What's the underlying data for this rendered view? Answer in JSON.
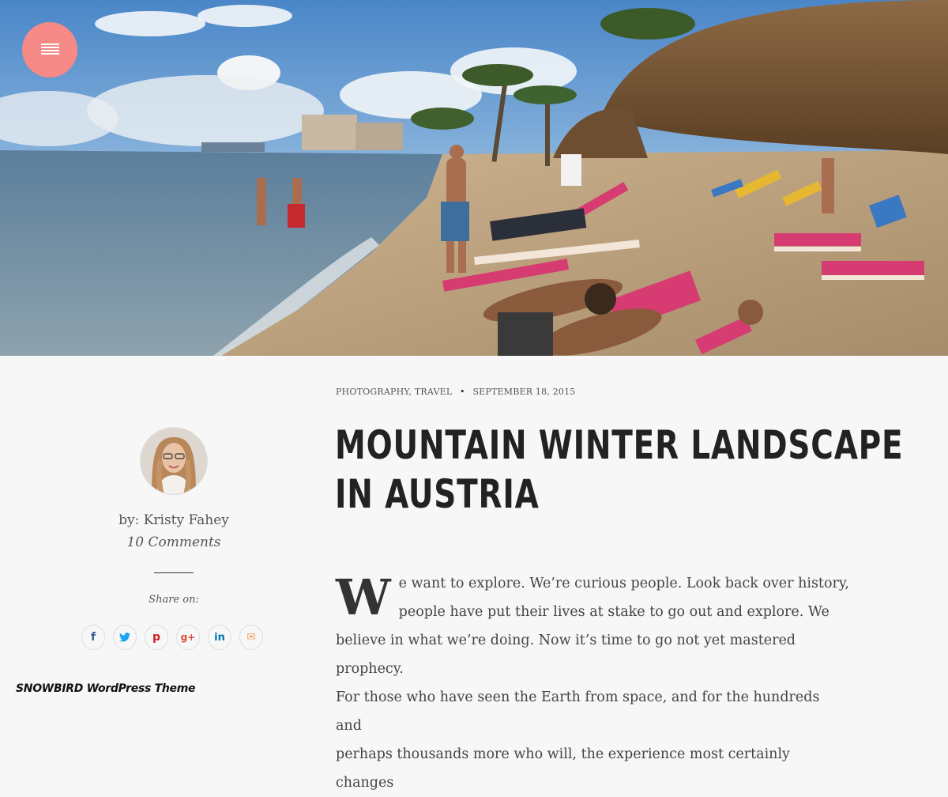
{
  "menu": {
    "icon": "hamburger-menu-icon"
  },
  "hero": {
    "description_icon": "beach-photo"
  },
  "post": {
    "categories": [
      "Photography",
      "Travel"
    ],
    "category_separator": ",",
    "dot": "•",
    "date": "September 18, 2015",
    "title_line1": "MOUNTAIN WINTER LANDSCAPE",
    "title_line2": "IN AUSTRIA",
    "dropcap": "W",
    "body_line1": "e want to explore. We’re curious people. Look back over history,",
    "body_line2": "people have put their lives at stake to go out and explore. We",
    "body_line3": "believe in what we’re doing. Now it’s time to go not yet mastered prophecy.",
    "body_line4": "For those who have seen the Earth from space, and for the hundreds and",
    "body_line5": "perhaps thousands more who will, the experience most certainly changes"
  },
  "author": {
    "by_label": "by: Kristy Fahey",
    "comments": "10 Comments",
    "share_label": "Share on:"
  },
  "share": {
    "facebook": "f",
    "twitter": "t",
    "pinterest": "p",
    "googleplus": "g+",
    "linkedin": "in",
    "email": "✉",
    "colors": {
      "facebook": "#3b5998",
      "twitter": "#1da1f2",
      "pinterest": "#cb2027",
      "googleplus": "#dd4b39",
      "linkedin": "#0077b5",
      "email": "#f0a060"
    }
  },
  "footer": {
    "credit": "SNOWBIRD WordPress Theme"
  },
  "colors": {
    "accent": "#f58a86",
    "text": "#222222"
  }
}
